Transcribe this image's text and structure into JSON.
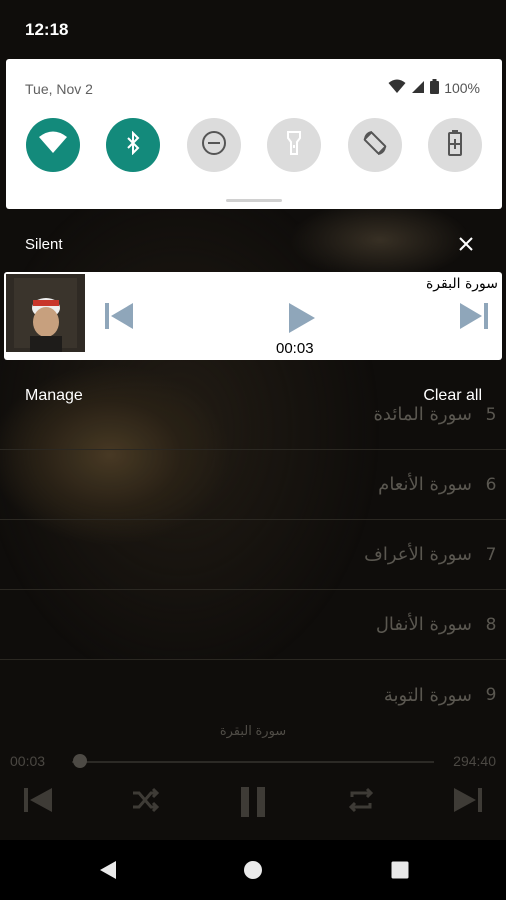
{
  "status_bar": {
    "time": "12:18"
  },
  "quick_settings": {
    "date": "Tue, Nov 2",
    "battery_percent": "100%",
    "tiles": [
      {
        "name": "wifi",
        "icon": "wifi-icon",
        "state": "on"
      },
      {
        "name": "bluetooth",
        "icon": "bluetooth-icon",
        "state": "on"
      },
      {
        "name": "do-not-disturb",
        "icon": "dnd-icon",
        "state": "off"
      },
      {
        "name": "flashlight",
        "icon": "flashlight-icon",
        "state": "off"
      },
      {
        "name": "auto-rotate",
        "icon": "rotate-icon",
        "state": "off"
      },
      {
        "name": "battery-saver",
        "icon": "battery-saver-icon",
        "state": "off"
      }
    ],
    "accent_color": "#138a7b"
  },
  "shade": {
    "silent_label": "Silent",
    "manage_label": "Manage",
    "clear_all_label": "Clear all"
  },
  "media_notification": {
    "title": "سورة البقرة",
    "elapsed": "00:03"
  },
  "background_app": {
    "list": [
      {
        "num": "5",
        "title": "سورة المائدة"
      },
      {
        "num": "6",
        "title": "سورة الأنعام"
      },
      {
        "num": "7",
        "title": "سورة الأعراف"
      },
      {
        "num": "8",
        "title": "سورة الأنفال"
      },
      {
        "num": "9",
        "title": "سورة التوبة"
      }
    ],
    "player": {
      "track_title": "سورة البقرة",
      "elapsed": "00:03",
      "duration": "294:40"
    }
  }
}
